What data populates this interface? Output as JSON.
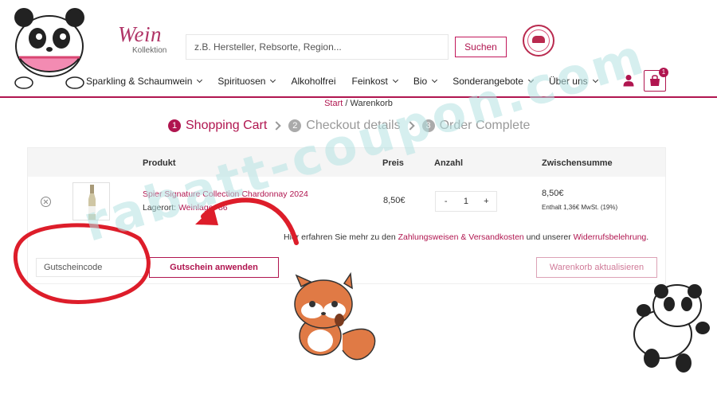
{
  "brand": {
    "script": "Wein",
    "sub": "Kollektion"
  },
  "search": {
    "placeholder": "z.B. Hersteller, Rebsorte, Region...",
    "button": "Suchen"
  },
  "nav": [
    {
      "label": "Sparkling & Schaumwein",
      "dropdown": true
    },
    {
      "label": "Spirituosen",
      "dropdown": true
    },
    {
      "label": "Alkoholfrei",
      "dropdown": false
    },
    {
      "label": "Feinkost",
      "dropdown": true
    },
    {
      "label": "Bio",
      "dropdown": true
    },
    {
      "label": "Sonderangebote",
      "dropdown": true
    },
    {
      "label": "Über uns",
      "dropdown": true
    }
  ],
  "cart_count": "1",
  "breadcrumb": {
    "home": "Start",
    "sep": " / ",
    "current": "Warenkorb"
  },
  "steps": [
    {
      "num": "1",
      "label": "Shopping Cart"
    },
    {
      "num": "2",
      "label": "Checkout details"
    },
    {
      "num": "3",
      "label": "Order Complete"
    }
  ],
  "table": {
    "headers": {
      "product": "Produkt",
      "price": "Preis",
      "qty": "Anzahl",
      "subtotal": "Zwischensumme"
    },
    "item": {
      "name": "Spier Signature Collection Chardonnay 2024",
      "lager_label": "Lagerort: ",
      "lager_value": "Weinlager 86",
      "price": "8,50€",
      "qty_minus": "-",
      "qty": "1",
      "qty_plus": "+",
      "subtotal": "8,50€",
      "tax": "Enthalt 1,36€ MwSt. (19%)"
    }
  },
  "info": {
    "prefix": "Hier erfahren Sie mehr zu den ",
    "link1": "Zahlungsweisen & Versandkosten",
    "middle": " und unserer ",
    "link2": "Widerrufsbelehrung",
    "suffix": "."
  },
  "coupon": {
    "placeholder": "Gutscheincode",
    "apply": "Gutschein anwenden"
  },
  "update_button": "Warenkorb aktualisieren",
  "watermark": "rabatt-coupon.com",
  "colors": {
    "accent": "#b0154f",
    "watermark": "#b4e1e1",
    "arrow": "#dd1d2a"
  }
}
